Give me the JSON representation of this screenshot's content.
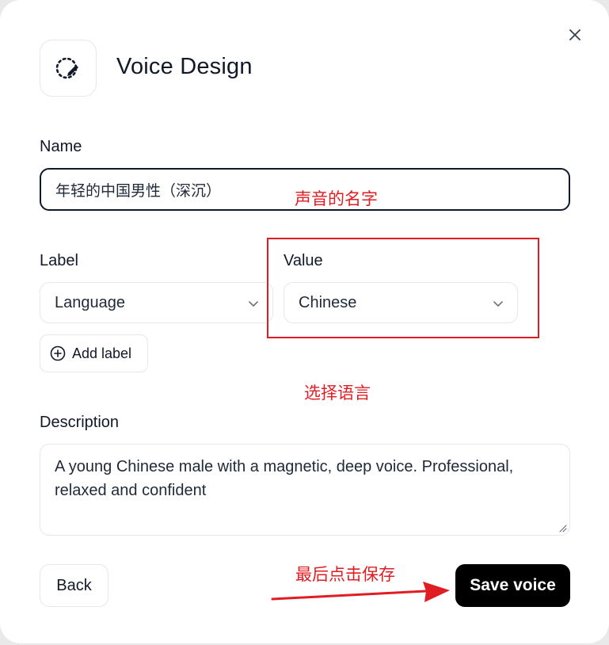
{
  "dialog": {
    "title": "Voice Design",
    "header_icon": "pencil-dashed-circle-icon",
    "close_icon": "close-icon"
  },
  "name_field": {
    "label": "Name",
    "value": "年轻的中国男性（深沉）"
  },
  "label_field": {
    "label": "Label",
    "selected": "Language",
    "icon": "chevron-down-icon"
  },
  "value_field": {
    "label": "Value",
    "selected": "Chinese",
    "icon": "chevron-down-icon"
  },
  "add_label_button": {
    "label": "Add label",
    "icon": "plus-circle-icon"
  },
  "description_field": {
    "label": "Description",
    "value": "A young Chinese male with a magnetic, deep voice. Professional, relaxed and confident"
  },
  "buttons": {
    "back": "Back",
    "save": "Save voice"
  },
  "annotations": {
    "name_note": "声音的名字",
    "language_note": "选择语言",
    "save_note": "最后点击保存",
    "color": "#e11d24"
  }
}
